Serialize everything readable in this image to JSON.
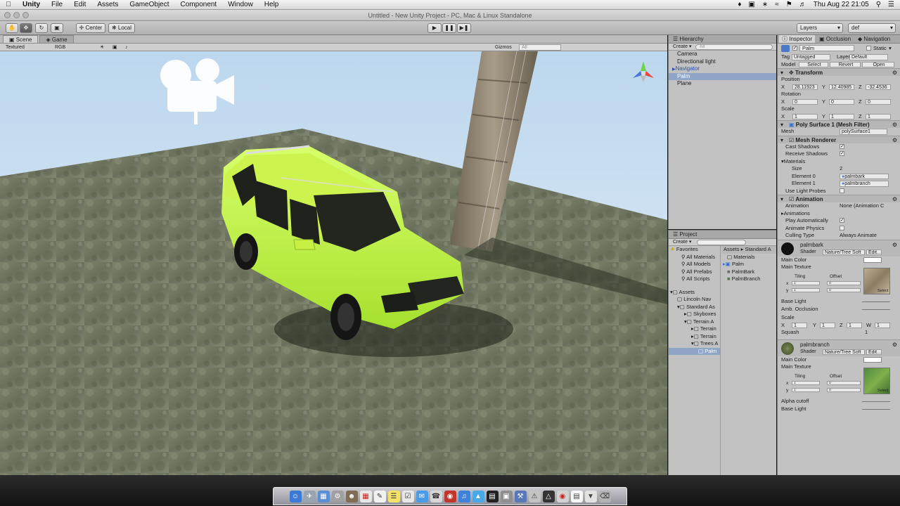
{
  "menubar": {
    "app": "Unity",
    "items": [
      "File",
      "Edit",
      "Assets",
      "GameObject",
      "Component",
      "Window",
      "Help"
    ],
    "clock": "Thu Aug 22  21:05"
  },
  "window": {
    "title": "Untitled - New Unity Project - PC, Mac & Linux Standalone"
  },
  "toolbar": {
    "center": "Center",
    "local": "Local",
    "layers": "Layers",
    "layout": "def"
  },
  "scene": {
    "tabs": [
      "Scene",
      "Game"
    ],
    "mode": "Textured",
    "color": "RGB",
    "gizmos": "Gizmos",
    "search": "All"
  },
  "hierarchy": {
    "title": "Hierarchy",
    "create": "Create",
    "search": "All",
    "items": [
      {
        "label": "Camera"
      },
      {
        "label": "Directional light"
      },
      {
        "label": "Navigator"
      },
      {
        "label": "Palm"
      },
      {
        "label": "Plane"
      }
    ]
  },
  "project": {
    "title": "Project",
    "create": "Create",
    "favorites": "Favorites",
    "fav_items": [
      "All Materials",
      "All Models",
      "All Prefabs",
      "All Scripts"
    ],
    "assets": "Assets",
    "asset_tree": [
      "Lincoln Nav",
      "Standard As",
      "Skyboxes",
      "Terrain A",
      "Terrain",
      "Terrain",
      "Trees A",
      "Palm"
    ],
    "breadcrumb": [
      "Assets",
      "Standard A"
    ],
    "files": [
      "Materials",
      "Palm",
      "PalmBark",
      "PalmBranch"
    ]
  },
  "inspector": {
    "tabs": [
      "Inspector",
      "Occlusion",
      "Navigation"
    ],
    "object_name": "Palm",
    "static_label": "Static",
    "tag_label": "Tag",
    "tag_value": "Untagged",
    "layer_label": "Layer",
    "layer_value": "Default",
    "model_label": "Model",
    "model_buttons": [
      "Select",
      "Revert",
      "Open"
    ],
    "transform": {
      "title": "Transform",
      "position_label": "Position",
      "position": {
        "x": "28.11923",
        "y": "12.40985",
        "z": "-32.4536"
      },
      "rotation_label": "Rotation",
      "rotation": {
        "x": "0",
        "y": "0",
        "z": "0"
      },
      "scale_label": "Scale",
      "scale": {
        "x": "1",
        "y": "1",
        "z": "1"
      }
    },
    "mesh_filter": {
      "title": "Poly Surface 1 (Mesh Filter)",
      "mesh_label": "Mesh",
      "mesh_value": "polySurface1"
    },
    "mesh_renderer": {
      "title": "Mesh Renderer",
      "cast_shadows": "Cast Shadows",
      "receive_shadows": "Receive Shadows",
      "materials": "Materials",
      "size_label": "Size",
      "size": "2",
      "element0_label": "Element 0",
      "element0": "palmbark",
      "element1_label": "Element 1",
      "element1": "palmbranch",
      "light_probes": "Use Light Probes"
    },
    "animation": {
      "title": "Animation",
      "animation_label": "Animation",
      "animation_value": "None (Animation C",
      "animations_label": "Animations",
      "play_auto": "Play Automatically",
      "animate_physics": "Animate Physics",
      "culling_label": "Culling Type",
      "culling_value": "Always Animate"
    },
    "material1": {
      "name": "palmbark",
      "shader_label": "Shader",
      "shader": "Nature/Tree Soft O",
      "edit": "Edit...",
      "main_color": "Main Color",
      "main_texture": "Main Texture",
      "tiling": "Tiling",
      "offset": "Offset",
      "tile_x": "1",
      "tile_y": "1",
      "off_x": "0",
      "off_y": "0",
      "select": "Select",
      "base_light": "Base Light",
      "amb_occlusion": "Amb. Occlusion",
      "scale_label": "Scale",
      "scale": {
        "x": "1",
        "y": "1",
        "z": "1",
        "w": "1"
      },
      "squash": "Squash",
      "squash_value": "1"
    },
    "material2": {
      "name": "palmbranch",
      "shader_label": "Shader",
      "shader": "Nature/Tree Soft O",
      "edit": "Edit...",
      "main_color": "Main Color",
      "main_texture": "Main Texture",
      "tiling": "Tiling",
      "offset": "Offset",
      "tile_x": "1",
      "tile_y": "1",
      "off_x": "0",
      "off_y": "0",
      "select": "Select",
      "alpha_cutoff": "Alpha cutoff",
      "base_light": "Base Light"
    }
  },
  "colors": {
    "selection": "#8fa6c9",
    "car": "#b7f239",
    "prefab_text": "#2a4fb5"
  }
}
